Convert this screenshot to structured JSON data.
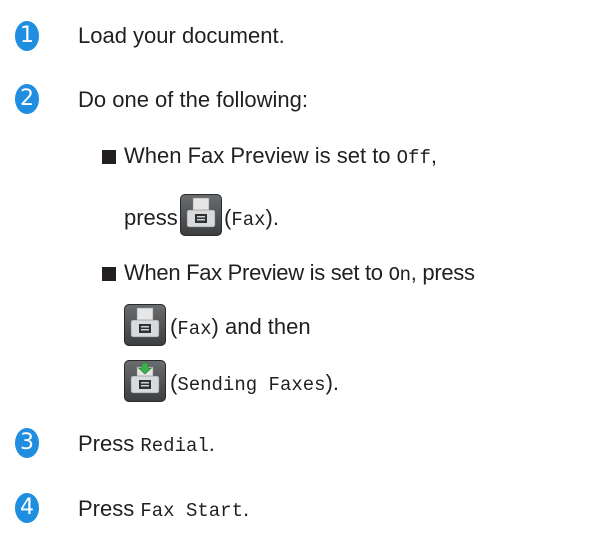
{
  "steps": [
    {
      "number": "1",
      "text": "Load your document."
    },
    {
      "number": "2",
      "text": "Do one of the following:"
    },
    {
      "number": "3",
      "text_before": "Press ",
      "code": "Redial",
      "text_after": "."
    },
    {
      "number": "4",
      "text_before": "Press ",
      "code": "Fax Start",
      "text_after": "."
    }
  ],
  "option1": {
    "line1_text": "When Fax Preview is set to ",
    "line1_code": "Off",
    "line1_end": ",",
    "press_text": "press",
    "icon": "fax-icon",
    "paren_open": " (",
    "code": "Fax",
    "paren_close": ")."
  },
  "option2": {
    "line1_text": "When Fax Preview is set to ",
    "line1_code": "On",
    "line1_end": ", press",
    "icon1": "fax-icon",
    "icon1_paren_open": "(",
    "icon1_code": "Fax",
    "icon1_after": ") and then",
    "icon2": "sending-faxes-icon",
    "icon2_paren_open": "(",
    "icon2_code": "Sending Faxes",
    "icon2_after": ")."
  },
  "colors": {
    "badge": "#1f8de0",
    "text": "#231f20"
  }
}
